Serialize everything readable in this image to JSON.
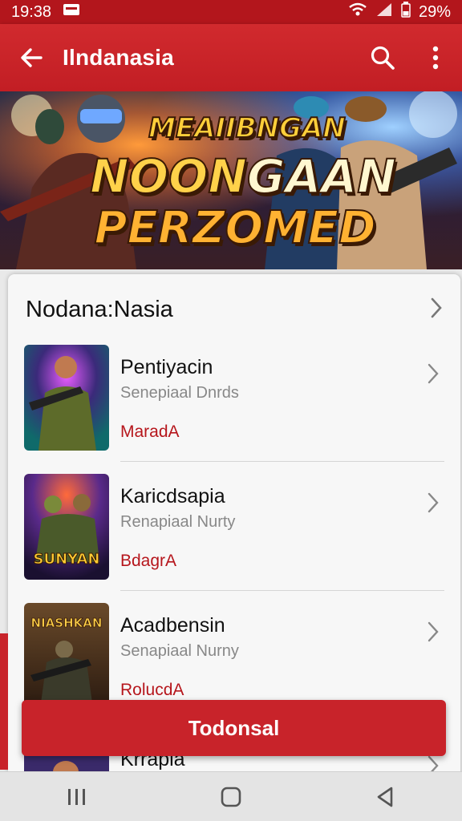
{
  "status": {
    "time": "19:38",
    "battery": "29%"
  },
  "app_bar": {
    "title": "Ilndanasia"
  },
  "banner": {
    "line1": "MEAIIBNGAN",
    "line2a": "NOON",
    "line2b": "GAAN",
    "line3": "PERZOMED"
  },
  "section": {
    "title": "Nodana:Nasia",
    "items": [
      {
        "name": "Pentiyacin",
        "subtitle": "Senepiaal Dnrds",
        "tag": "MaradA",
        "thumb_text": ""
      },
      {
        "name": "Karicdsapia",
        "subtitle": "Renapiaal Nurty",
        "tag": "BdagrA",
        "thumb_text": "SUNYAN"
      },
      {
        "name": "Acadbensin",
        "subtitle": "Senapiaal Nurny",
        "tag": "RolucdA",
        "thumb_text": "NIASHKAN"
      },
      {
        "name": "Krrapia",
        "subtitle": "",
        "tag": "",
        "thumb_text": ""
      }
    ]
  },
  "cta": {
    "label": "Todonsal"
  },
  "colors": {
    "primary": "#c8232a",
    "tag": "#b6161c"
  }
}
